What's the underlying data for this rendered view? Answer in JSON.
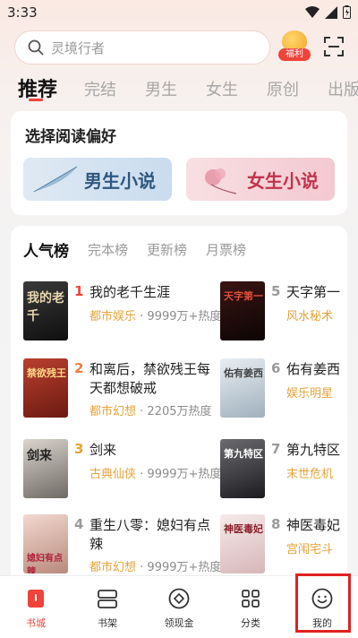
{
  "status_bar": {
    "time": "3:33"
  },
  "search": {
    "placeholder": "灵境行者",
    "welfare_label": "福利"
  },
  "top_tabs": [
    {
      "label": "推荐",
      "active": true
    },
    {
      "label": "完结"
    },
    {
      "label": "男生"
    },
    {
      "label": "女生"
    },
    {
      "label": "原创"
    },
    {
      "label": "出版"
    }
  ],
  "preference": {
    "title": "选择阅读偏好",
    "male_label": "男生小说",
    "female_label": "女生小说"
  },
  "ranking": {
    "tabs": [
      {
        "label": "人气榜",
        "active": true
      },
      {
        "label": "完本榜"
      },
      {
        "label": "更新榜"
      },
      {
        "label": "月票榜"
      }
    ],
    "left_books": [
      {
        "rank": "1",
        "title": "我的老千生涯",
        "genre": "都市娱乐",
        "heat": "· 9999万+热度",
        "cover_text": "我的老千"
      },
      {
        "rank": "2",
        "title": "和离后，禁欲残王每天都想破戒",
        "genre": "都市幻想",
        "heat": "· 2205万热度",
        "cover_text": "禁欲残王"
      },
      {
        "rank": "3",
        "title": "剑来",
        "genre": "古典仙侠",
        "heat": "· 9999万+热度",
        "cover_text": "剑来"
      },
      {
        "rank": "4",
        "title": "重生八零：媳妇有点辣",
        "genre": "都市幻想",
        "heat": "· 9999万+热度",
        "cover_text": "媳妇有点辣"
      }
    ],
    "right_books": [
      {
        "rank": "5",
        "title": "天字第一",
        "genre": "风水秘术",
        "cover_text": "天字第一"
      },
      {
        "rank": "6",
        "title": "佑有姜西",
        "genre": "娱乐明星",
        "cover_text": "佑有姜西"
      },
      {
        "rank": "7",
        "title": "第九特区",
        "genre": "末世危机",
        "cover_text": "第九特区"
      },
      {
        "rank": "8",
        "title": "神医毒妃",
        "genre": "宫闱宅斗",
        "cover_text": "神医毒妃"
      }
    ]
  },
  "bottom_nav": [
    {
      "label": "书城",
      "icon": "bookstore-icon",
      "active": true
    },
    {
      "label": "书架",
      "icon": "bookshelf-icon"
    },
    {
      "label": "领现金",
      "icon": "cash-icon"
    },
    {
      "label": "分类",
      "icon": "category-icon"
    },
    {
      "label": "我的",
      "icon": "profile-icon"
    }
  ],
  "colors": {
    "accent": "#f0433a",
    "genre": "#e6a33b",
    "highlight": "#e02020"
  }
}
